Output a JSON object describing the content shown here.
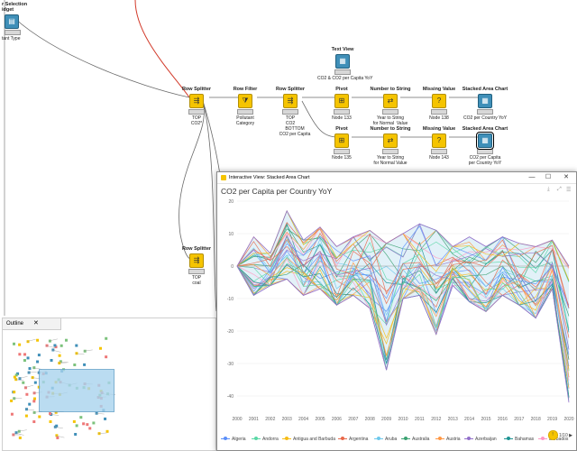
{
  "canvas": {
    "top_labels": [
      {
        "id": "selection",
        "title": "r Selection",
        "subtitle": "idget",
        "caption": "tant Type"
      }
    ],
    "nodes": [
      {
        "id": "text-view",
        "title": "Text View",
        "icon": "view",
        "caption": "CO2 & CO2 per Capita YoY"
      },
      {
        "id": "row-splitter-1",
        "title": "Row Splitter",
        "icon": "splitter",
        "caption": "TOP\nCO2*"
      },
      {
        "id": "row-filter",
        "title": "Row Filter",
        "icon": "filter",
        "caption": "Pollutant\nCategory"
      },
      {
        "id": "row-splitter-2",
        "title": "Row Splitter",
        "icon": "splitter",
        "caption": "TOP\nCO2"
      },
      {
        "id": "pivot-1",
        "title": "Pivot",
        "icon": "pivot",
        "caption": "Node 133"
      },
      {
        "id": "num2str-1",
        "title": "Number to String",
        "icon": "num2str",
        "caption": "Year to String\nfor Normal  Value"
      },
      {
        "id": "missing-1",
        "title": "Missing Value",
        "icon": "missing",
        "caption": "Node 138"
      },
      {
        "id": "sac-1",
        "title": "Stacked Area Chart",
        "icon": "view",
        "caption": "CO2 per Country YoY"
      },
      {
        "id": "pivot-2",
        "title": "Pivot",
        "icon": "pivot",
        "caption": "Node 135"
      },
      {
        "id": "num2str-2",
        "title": "Number to String",
        "icon": "num2str",
        "caption": "Year to String\nfor Normal Value"
      },
      {
        "id": "missing-2",
        "title": "Missing Value",
        "icon": "missing",
        "caption": "Node 143"
      },
      {
        "id": "sac-2",
        "title": "Stacked Area Chart",
        "icon": "view",
        "caption": "CO2 per Capita\nper Country YoY"
      },
      {
        "id": "row-splitter-3",
        "title": "Row Splitter",
        "icon": "splitter",
        "caption": "TOP\ncoal"
      }
    ],
    "annotation_bottom": "BOTTOM\nCO2 per Capita"
  },
  "outline": {
    "tab_label": "Outline"
  },
  "view_window": {
    "title": "Interactive View: Stacked Area Chart",
    "chart_title": "CO2 per Capita per Country YoY",
    "legend": [
      "Algeria",
      "Andorra",
      "Antigua and Barbuda",
      "Argentina",
      "Aruba",
      "Australia",
      "Austria",
      "Azerbaijan",
      "Bahamas",
      "Barbados"
    ],
    "pager": "1/10"
  },
  "chart_data": {
    "type": "area",
    "title": "CO2 per Capita per Country YoY",
    "x": [
      2000,
      2001,
      2002,
      2003,
      2004,
      2005,
      2006,
      2007,
      2008,
      2009,
      2010,
      2011,
      2012,
      2013,
      2014,
      2015,
      2016,
      2017,
      2018,
      2019,
      2020
    ],
    "yticks": [
      20,
      10,
      0,
      -10,
      -20,
      -30,
      -40
    ],
    "ylim": [
      -45,
      20
    ],
    "envelope_upper": [
      0,
      9,
      4,
      17,
      8,
      12,
      6,
      9,
      11,
      7,
      10,
      13,
      11,
      6,
      9,
      6,
      9,
      7,
      6,
      8,
      0
    ],
    "envelope_lower": [
      0,
      -9,
      -6,
      -4,
      -9,
      -7,
      -12,
      -9,
      -13,
      -32,
      -10,
      -9,
      -21,
      -6,
      -11,
      -14,
      -9,
      -12,
      -16,
      -7,
      -42
    ],
    "series_count": 10,
    "series_colors": [
      "#5b8ff9",
      "#5ad8a6",
      "#f6bd16",
      "#e8684a",
      "#6dc8ec",
      "#3ba272",
      "#ff9845",
      "#9270ca",
      "#1e9493",
      "#ff99c3"
    ]
  }
}
